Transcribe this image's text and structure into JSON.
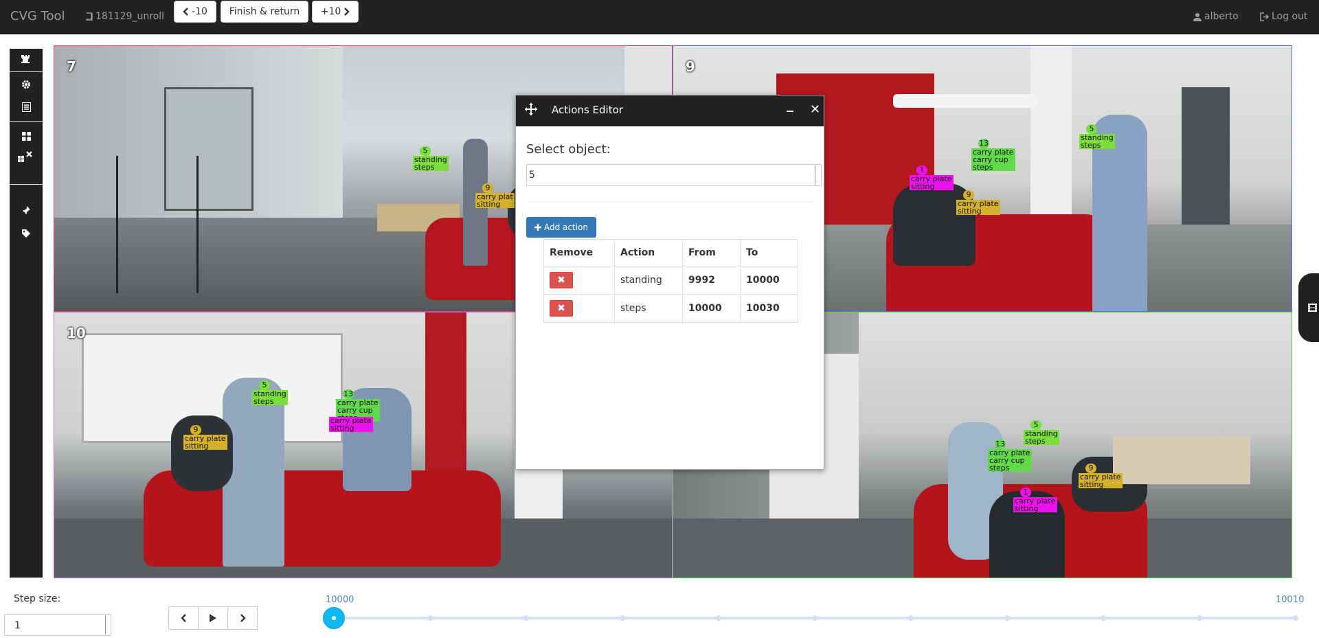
{
  "navbar": {
    "brand": "CVG Tool",
    "project": "181129_unroll",
    "back_label": "-10",
    "finish_label": "Finish & return",
    "forward_label": "+10",
    "user": "alberto",
    "logout": "Log out"
  },
  "views": [
    {
      "number": "7"
    },
    {
      "number": "9"
    },
    {
      "number": "10"
    },
    {
      "number": ""
    }
  ],
  "annotations": {
    "cam7": [
      {
        "id": "5",
        "lines": [
          "standing",
          "steps"
        ],
        "color": "#7cde3a"
      },
      {
        "id": "9",
        "lines": [
          "carry plat",
          "sitting"
        ],
        "color": "#d4b12a"
      }
    ],
    "cam9": [
      {
        "id": "5",
        "lines": [
          "standing",
          "steps"
        ],
        "color": "#7cde3a"
      },
      {
        "id": "13",
        "lines": [
          "carry plate",
          "carry cup",
          "steps"
        ],
        "color": "#62d94b"
      },
      {
        "id": "1",
        "lines": [
          "carry plate",
          "sitting"
        ],
        "color": "#ee11ee"
      },
      {
        "id": "9",
        "lines": [
          "carry plate",
          "sitting"
        ],
        "color": "#d4b12a"
      }
    ],
    "cam10": [
      {
        "id": "5",
        "lines": [
          "standing",
          "steps"
        ],
        "color": "#7cde3a"
      },
      {
        "id": "13",
        "lines": [
          "carry plate",
          "carry cup",
          "steps"
        ],
        "color": "#62d94b"
      },
      {
        "id": "9",
        "lines": [
          "carry plate",
          "sitting"
        ],
        "color": "#d4b12a"
      },
      {
        "id": "",
        "lines": [
          "carry plate",
          "sitting"
        ],
        "color": "#ee11ee"
      }
    ],
    "cam4": [
      {
        "id": "5",
        "lines": [
          "standing",
          "steps"
        ],
        "color": "#7cde3a"
      },
      {
        "id": "13",
        "lines": [
          "carry plate",
          "carry cup",
          "steps"
        ],
        "color": "#62d94b"
      },
      {
        "id": "9",
        "lines": [
          "carry plate",
          "sitting"
        ],
        "color": "#d4b12a"
      },
      {
        "id": "1",
        "lines": [
          "carry plate",
          "sitting"
        ],
        "color": "#ee11ee"
      }
    ]
  },
  "dialog": {
    "title": "Actions Editor",
    "select_label": "Select object:",
    "select_value": "5",
    "add_action_label": "Add action",
    "columns": [
      "Remove",
      "Action",
      "From",
      "To"
    ],
    "rows": [
      {
        "action": "standing",
        "from": "9992",
        "to": "10000"
      },
      {
        "action": "steps",
        "from": "10000",
        "to": "10030"
      }
    ]
  },
  "controls": {
    "step_size_label": "Step size:",
    "step_size_value": "1",
    "slider_min": "10000",
    "slider_max": "10010",
    "slider_value": 10000
  },
  "icons": {
    "toolbar": [
      "chess-rook-icon",
      "gear-icon",
      "list-icon",
      "grid-icon",
      "grid-remove-icon",
      "pin-icon",
      "tag-icon"
    ]
  },
  "colors": {
    "navbar": "#222222",
    "primary": "#337ab7",
    "danger": "#d9534f",
    "slider": "#0db9f0",
    "cell_borders": [
      "#e8426a",
      "#5a6de0",
      "#c070e0",
      "#58d05a"
    ]
  }
}
